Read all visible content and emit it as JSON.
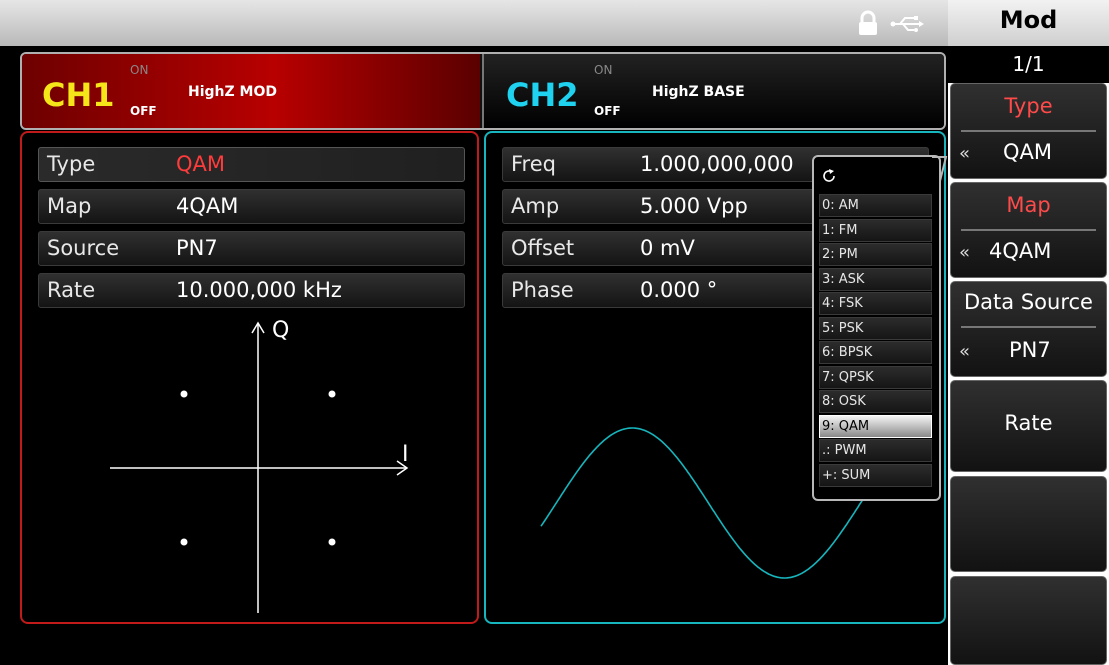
{
  "status": {
    "lock_icon": "lock-icon",
    "usb_icon": "usb-icon"
  },
  "ch1": {
    "name": "CH1",
    "on": "ON",
    "off": "OFF",
    "status": "HighZ MOD",
    "color": "#f5e61a"
  },
  "ch2": {
    "name": "CH2",
    "on": "ON",
    "off": "OFF",
    "status": "HighZ BASE",
    "color": "#1ed2f0"
  },
  "ch1_params": [
    {
      "label": "Type",
      "value": "QAM",
      "value_color": "#ff3b3b"
    },
    {
      "label": "Map",
      "value": "4QAM"
    },
    {
      "label": "Source",
      "value": "PN7"
    },
    {
      "label": "Rate",
      "value": "10.000,000 kHz"
    }
  ],
  "constellation": {
    "axis_q": "Q",
    "axis_i": "I",
    "points": [
      [
        -1,
        1
      ],
      [
        1,
        1
      ],
      [
        -1,
        -1
      ],
      [
        1,
        -1
      ]
    ]
  },
  "ch2_params": [
    {
      "label": "Freq",
      "value": "1.000,000,000"
    },
    {
      "label": "Amp",
      "value": "5.000 Vpp"
    },
    {
      "label": "Offset",
      "value": "0 mV"
    },
    {
      "label": "Phase",
      "value": "0.000 °"
    }
  ],
  "type_popup": {
    "refresh_icon": "refresh-icon",
    "items": [
      "0: AM",
      "1: FM",
      "2: PM",
      "3: ASK",
      "4: FSK",
      "5: PSK",
      "6: BPSK",
      "7: QPSK",
      "8: OSK",
      "9: QAM",
      ".: PWM",
      "+: SUM"
    ],
    "selected_index": 9
  },
  "menu": {
    "title": "Mod",
    "page": "1/1",
    "softkeys": [
      {
        "label": "Type",
        "value": "QAM"
      },
      {
        "label": "Map",
        "value": "4QAM"
      },
      {
        "label": "Data Source",
        "value": "PN7"
      },
      {
        "label": "Rate",
        "value": ""
      },
      {
        "label": "",
        "value": ""
      },
      {
        "label": "",
        "value": ""
      }
    ],
    "arrow_glyph": "«"
  },
  "colors": {
    "ch1_border": "#c11a1a",
    "ch2_border": "#17b5bd",
    "highlight_label": "#ff3b3b",
    "wave": "#17b5bd"
  }
}
